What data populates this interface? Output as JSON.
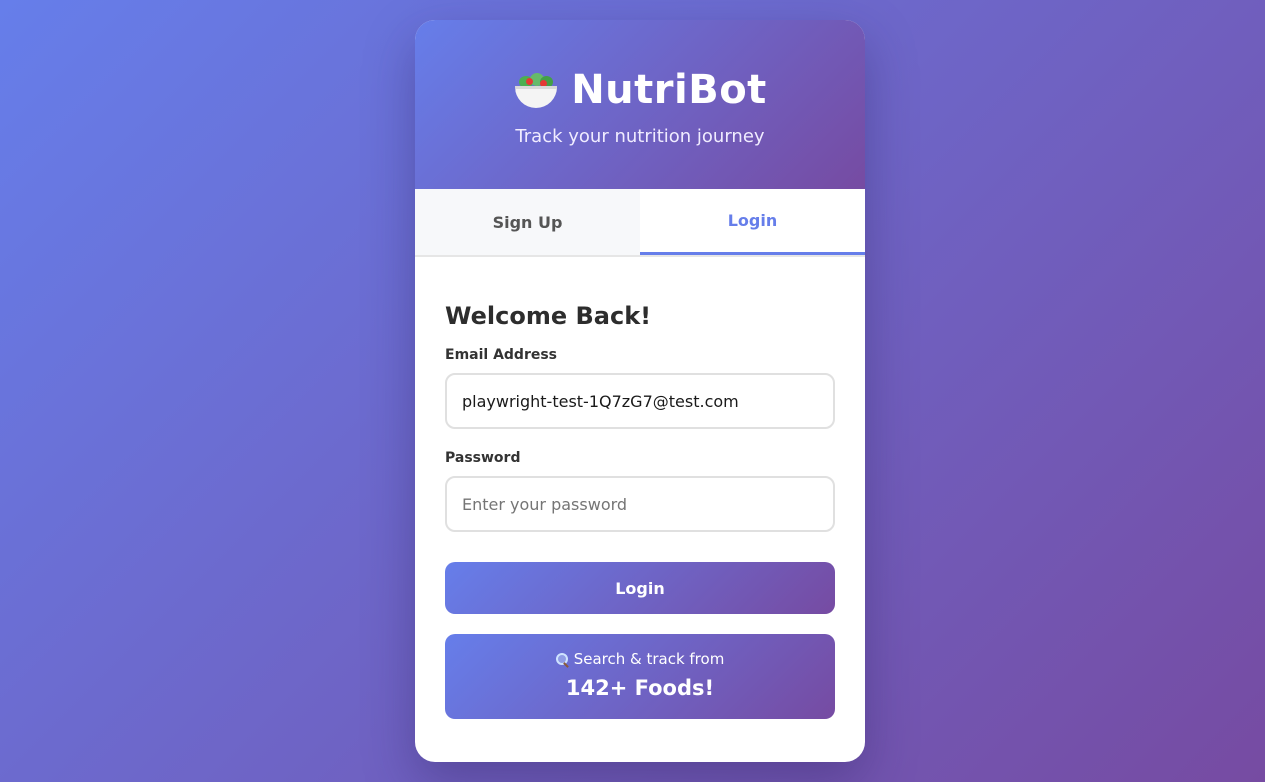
{
  "header": {
    "logo_icon": "salad-bowl-icon",
    "title": "NutriBot",
    "subtitle": "Track your nutrition journey"
  },
  "tabs": [
    {
      "label": "Sign Up",
      "active": false
    },
    {
      "label": "Login",
      "active": true
    }
  ],
  "form": {
    "title": "Welcome Back!",
    "email": {
      "label": "Email Address",
      "value": "playwright-test-1Q7zG7@test.com"
    },
    "password": {
      "label": "Password",
      "placeholder": "Enter your password",
      "value": ""
    },
    "submit_label": "Login"
  },
  "promo": {
    "icon": "search-icon",
    "line1": "Search & track from",
    "line2": "142+ Foods!"
  },
  "colors": {
    "gradient_start": "#667eea",
    "gradient_end": "#764ba2",
    "active_tab": "#667eea"
  }
}
